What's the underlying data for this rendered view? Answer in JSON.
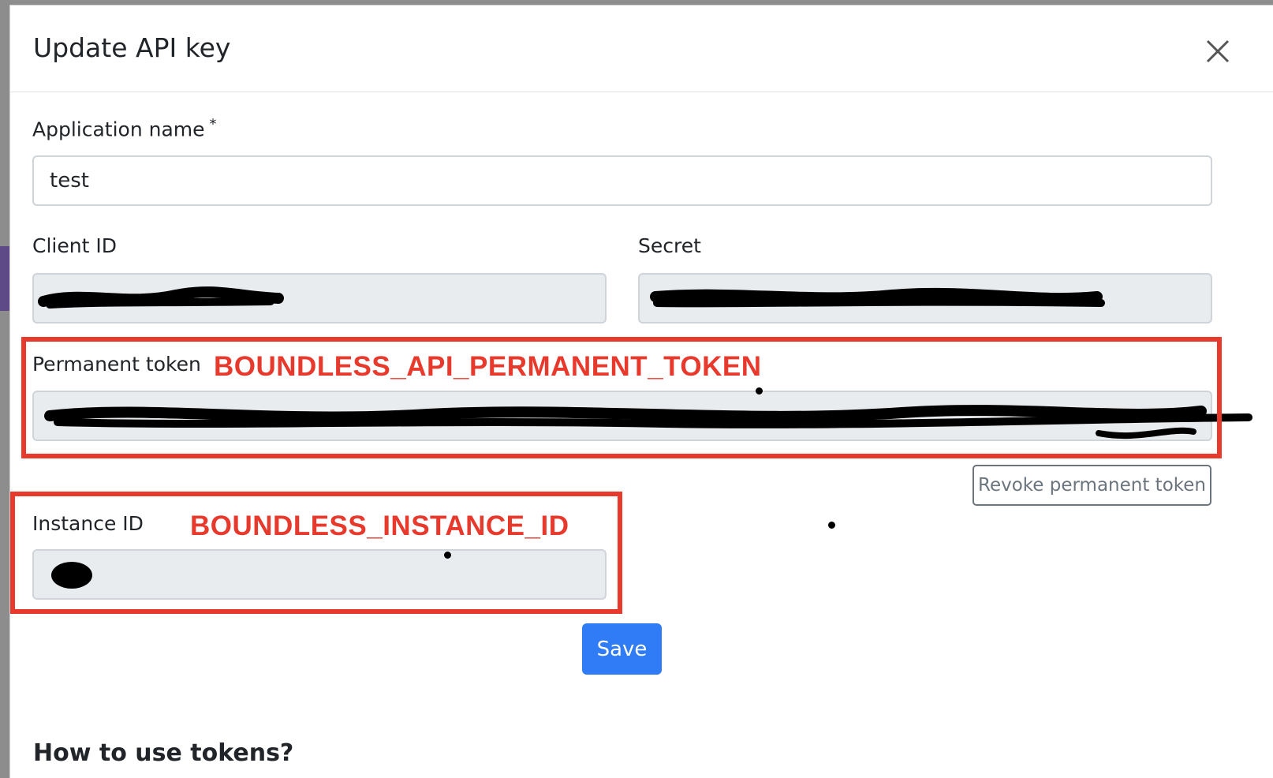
{
  "modal": {
    "title": "Update API key",
    "close_icon": "close-x-icon"
  },
  "form": {
    "application_name": {
      "label": "Application name",
      "required_marker": "*",
      "value": "test"
    },
    "client_id": {
      "label": "Client ID",
      "value_state": "redacted"
    },
    "secret": {
      "label": "Secret",
      "value_state": "redacted"
    },
    "permanent_token": {
      "label": "Permanent token",
      "value_state": "redacted"
    },
    "instance_id": {
      "label": "Instance ID",
      "value_state": "redacted"
    }
  },
  "annotations": {
    "permanent_token_tag": "BOUNDLESS_API_PERMANENT_TOKEN",
    "instance_id_tag": "BOUNDLESS_INSTANCE_ID",
    "color": "#e8392d"
  },
  "buttons": {
    "revoke_label": "Revoke permanent token",
    "save_label": "Save"
  },
  "footer": {
    "section_heading": "How to use tokens?"
  },
  "colors": {
    "primary": "#2f7cf6",
    "readonly_bg": "#e9ecef",
    "border": "#ced4da",
    "secondary": "#6c757d"
  }
}
